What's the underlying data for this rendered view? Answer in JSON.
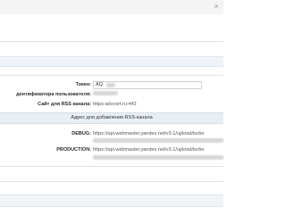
{
  "form": {
    "close_glyph": "×",
    "token_label": "Токен:",
    "token_value": "AQ",
    "user_id_label": "дентификатора пользователя:",
    "rss_site_label": "Сайт для RSS канала:",
    "rss_site_value": "https:advcort.ru:443",
    "rss_section_title": "Адрес для добавления RSS-канала",
    "debug_label": "DEBUG:",
    "debug_url": "https://api.webmaster.yandex.net/v3.1/upload/turbo",
    "production_label": "PRODUCTION:",
    "production_url": "https://api.webmaster.yandex.net/v3.1/upload/turbo"
  },
  "colors": {
    "header_bg": "#f4f4f4",
    "section_bg": "#e8eef4",
    "border": "#cfcfcf"
  }
}
